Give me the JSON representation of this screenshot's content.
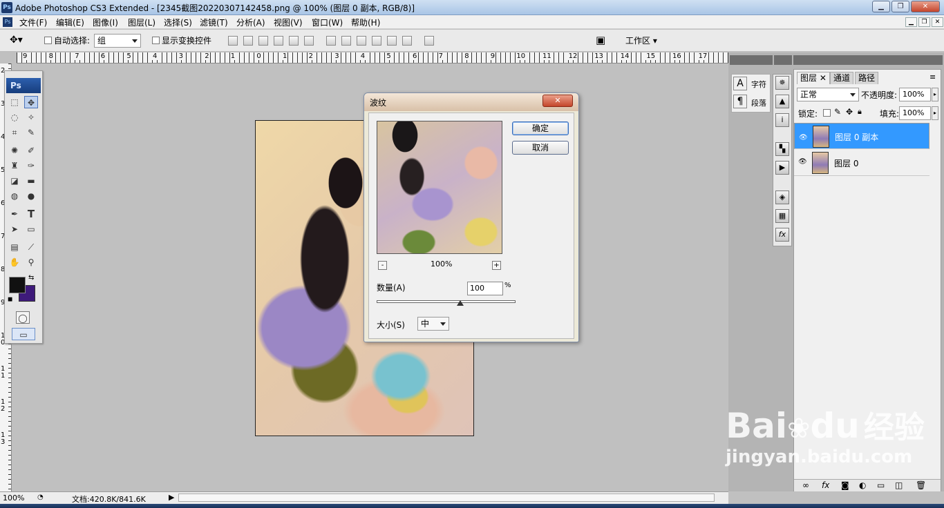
{
  "window": {
    "title": "Adobe Photoshop CS3 Extended - [2345截图20220307142458.png @ 100% (图层 0 副本, RGB/8)]",
    "minimize": "▁",
    "maximize": "❐",
    "close": "✕"
  },
  "menu": [
    "文件(F)",
    "编辑(E)",
    "图像(I)",
    "图层(L)",
    "选择(S)",
    "滤镜(T)",
    "分析(A)",
    "视图(V)",
    "窗口(W)",
    "帮助(H)"
  ],
  "doc_controls": [
    "▁",
    "❐",
    "✕"
  ],
  "options": {
    "auto_select_label": "自动选择:",
    "auto_select_value": "组",
    "show_transform_label": "显示变换控件",
    "workspace": "工作区"
  },
  "ruler_h": [
    "9",
    "8",
    "7",
    "6",
    "5",
    "4",
    "3",
    "2",
    "1",
    "0",
    "1",
    "2",
    "3",
    "4",
    "5",
    "6",
    "7",
    "8",
    "9",
    "10",
    "11",
    "12",
    "13",
    "14",
    "15",
    "16",
    "17"
  ],
  "ruler_v": [
    "2",
    "3",
    "4",
    "5",
    "6",
    "7",
    "8",
    "9",
    "1\n0",
    "1\n1",
    "1\n2",
    "1\n3"
  ],
  "toolbox": {
    "logo": "Ps"
  },
  "colors": {
    "foreground": "#111111",
    "background": "#3e1a7a",
    "selected_layer": "#3399ff",
    "dialog_close": "#c4462b"
  },
  "dialog": {
    "title": "波纹",
    "ok": "确定",
    "cancel": "取消",
    "zoom": "100%",
    "zoom_minus": "-",
    "zoom_plus": "+",
    "amount_label": "数量(A)",
    "amount_value": "100",
    "amount_unit": "%",
    "amount_slider": 0.6,
    "size_label": "大小(S)",
    "size_value": "中"
  },
  "char_panel": {
    "char": "字符",
    "para": "段落"
  },
  "layers_panel": {
    "tabs": [
      "图层",
      "通道",
      "路径"
    ],
    "blend_mode": "正常",
    "opacity_label": "不透明度:",
    "opacity_value": "100%",
    "lock_label": "锁定:",
    "fill_label": "填充:",
    "fill_value": "100%",
    "layers": [
      {
        "name": "图层 0 副本",
        "selected": true
      },
      {
        "name": "图层 0",
        "selected": false
      }
    ],
    "bottom_icons": [
      "link-icon",
      "fx-icon",
      "mask-icon",
      "adjust-icon",
      "folder-icon",
      "new-layer-icon",
      "trash-icon"
    ]
  },
  "status": {
    "zoom": "100%",
    "doc": "文档:420.8K/841.6K"
  },
  "watermark": {
    "brand": "Bai",
    "brand2": "du",
    "cn": "经验",
    "url": "jingyan.baidu.com"
  }
}
